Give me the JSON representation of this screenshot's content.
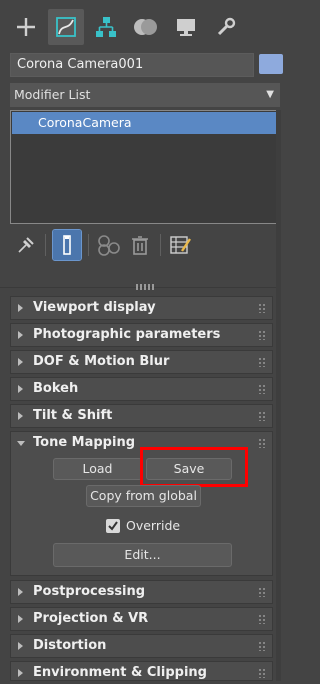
{
  "object": {
    "name": "Corona Camera001",
    "color": "#8eaadd"
  },
  "modifier_list": {
    "label": "Modifier List"
  },
  "stack": {
    "items": [
      "CoronaCamera"
    ]
  },
  "rollouts": {
    "viewport_display": "Viewport display",
    "photographic": "Photographic parameters",
    "dof": "DOF & Motion Blur",
    "bokeh": "Bokeh",
    "tilt_shift": "Tilt & Shift",
    "tone_mapping": "Tone Mapping",
    "postprocessing": "Postprocessing",
    "projection": "Projection & VR",
    "distortion": "Distortion",
    "environment": "Environment & Clipping"
  },
  "tone_mapping": {
    "load_label": "Load",
    "save_label": "Save",
    "copy_label": "Copy from global",
    "override_label": "Override",
    "override_checked": true,
    "edit_label": "Edit..."
  },
  "colors": {
    "accent": "#5a88c4",
    "highlight": "#ff0000"
  }
}
